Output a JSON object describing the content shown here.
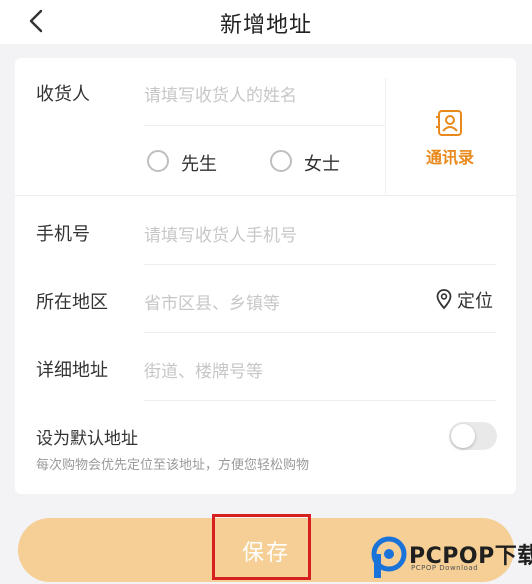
{
  "header": {
    "title": "新增地址"
  },
  "form": {
    "recipient": {
      "label": "收货人",
      "placeholder": "请填写收货人的姓名"
    },
    "gender": {
      "options": [
        "先生",
        "女士"
      ]
    },
    "contacts": {
      "label": "通讯录"
    },
    "phone": {
      "label": "手机号",
      "placeholder": "请填写收货人手机号"
    },
    "region": {
      "label": "所在地区",
      "placeholder": "省市区县、乡镇等",
      "locate_label": "定位"
    },
    "detail": {
      "label": "详细地址",
      "placeholder": "街道、楼牌号等"
    },
    "default_address": {
      "title": "设为默认地址",
      "hint": "每次购物会优先定位至该地址，方便您轻松购物",
      "enabled": false
    }
  },
  "footer": {
    "save_label": "保存"
  },
  "watermark": {
    "brand": "PCPOP下载",
    "sub": "PCPOP Download"
  },
  "colors": {
    "accent": "#e8891c",
    "save_button": "#f5cf95",
    "highlight": "#d62020"
  }
}
